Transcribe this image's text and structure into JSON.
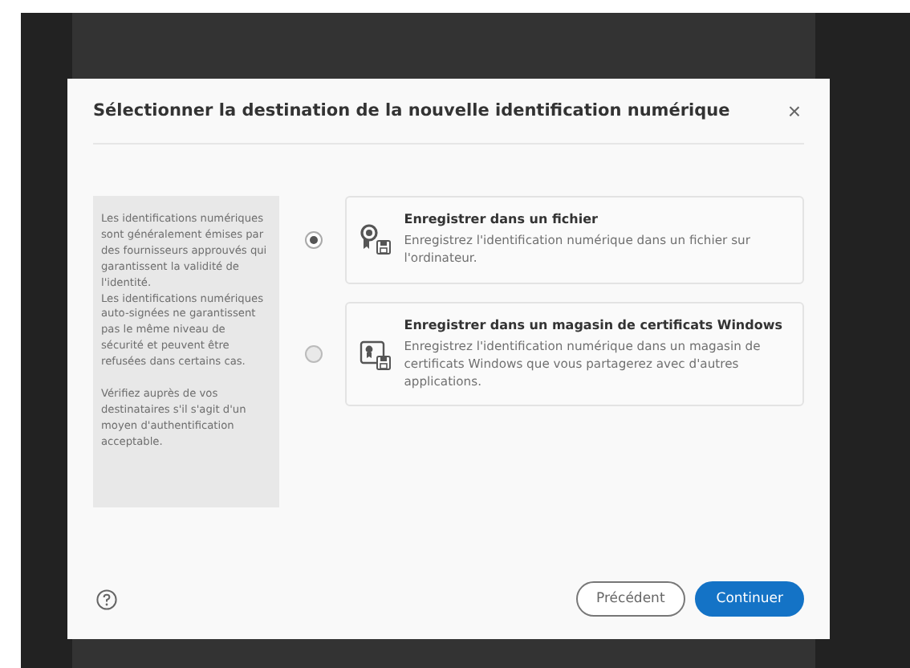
{
  "dialog": {
    "title": "Sélectionner la destination de la nouvelle identification numérique",
    "close": "×",
    "info_text": "Les identifications numériques sont généralement émises par des fournisseurs approuvés qui garantissent la validité de l'identité.\nLes identifications numériques auto-signées ne garantissent pas le même niveau de sécurité et peuvent être refusées dans certains cas.\n\nVérifiez auprès de vos destinataires s'il s'agit d'un moyen d'authentification acceptable.",
    "options": [
      {
        "kind": "file",
        "title": "Enregistrer dans un fichier",
        "description": "Enregistrez l'identification numérique dans un fichier sur l'ordinateur.",
        "selected": true
      },
      {
        "kind": "store",
        "title": "Enregistrer dans un magasin de certificats Windows",
        "description": "Enregistrez l'identification numérique dans un magasin de certificats Windows que vous partagerez avec d'autres applications.",
        "selected": false
      }
    ],
    "buttons": [
      {
        "kind": "secondary",
        "label": "Précédent"
      },
      {
        "kind": "primary",
        "label": "Continuer"
      }
    ]
  }
}
